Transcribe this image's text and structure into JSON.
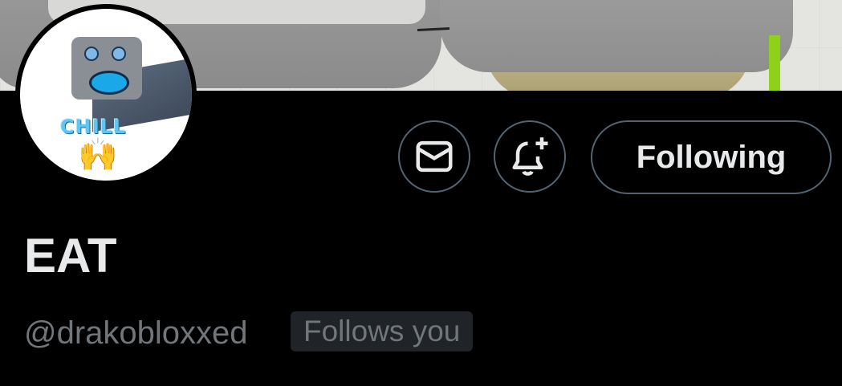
{
  "profile": {
    "display_name": "EAT",
    "handle": "@drakobloxxed",
    "follows_you_badge": "Follows you",
    "avatar_text": "CHILL"
  },
  "actions": {
    "message_icon": "envelope-icon",
    "notify_icon": "bell-plus-icon",
    "following_label": "Following"
  },
  "colors": {
    "background": "#000000",
    "text_primary": "#e7e9ea",
    "text_secondary": "#71767b",
    "button_border": "#536471",
    "badge_background": "#202327",
    "banner_accent": "#8ed01a"
  }
}
